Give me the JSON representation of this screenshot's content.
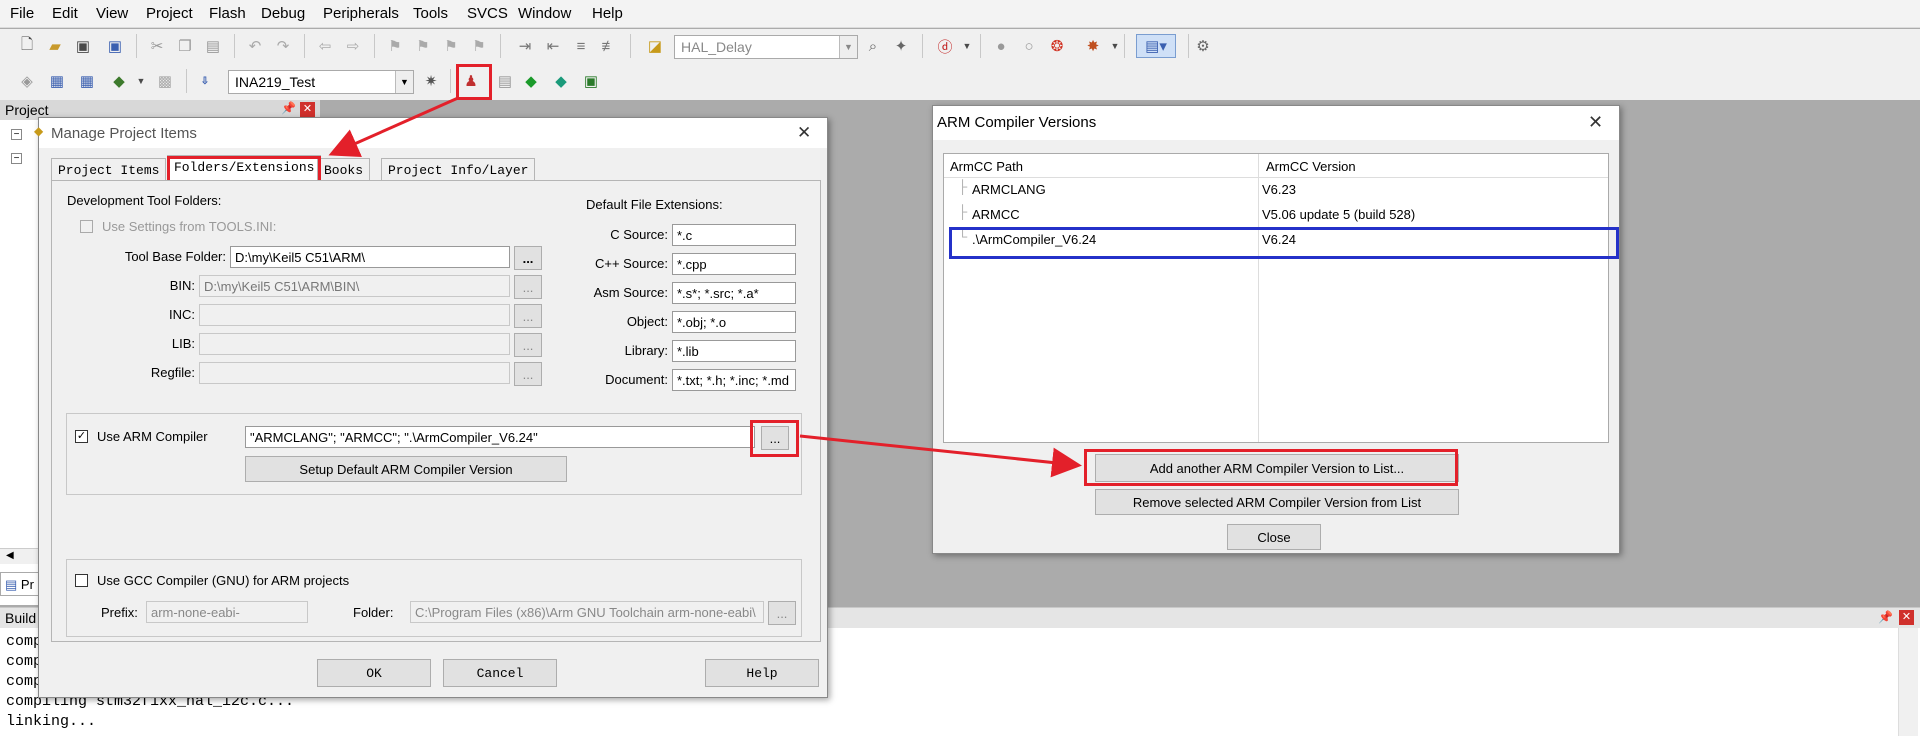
{
  "menu": [
    "File",
    "Edit",
    "View",
    "Project",
    "Flash",
    "Debug",
    "Peripherals",
    "Tools",
    "SVCS",
    "Window",
    "Help"
  ],
  "toolbar": {
    "find_combo": "HAL_Delay",
    "target_combo": "INA219_Test"
  },
  "project_pane": {
    "title": "Project",
    "bottom_tab": "Pr"
  },
  "build_output": {
    "title": "Build O",
    "lines": [
      "comp",
      "comp",
      "comp",
      "compiling stm32f1xx_hal_i2c.c...",
      "linking..."
    ]
  },
  "manage_dialog": {
    "title": "Manage Project Items",
    "tabs": [
      "Project Items",
      "Folders/Extensions",
      "Books",
      "Project Info/Layer"
    ],
    "dev_folders_title": "Development Tool Folders:",
    "use_tools_ini": "Use Settings from TOOLS.INI:",
    "tool_base_label": "Tool Base Folder:",
    "tool_base_value": "D:\\my\\Keil5 C51\\ARM\\",
    "bin_label": "BIN:",
    "bin_value": "D:\\my\\Keil5 C51\\ARM\\BIN\\",
    "inc_label": "INC:",
    "lib_label": "LIB:",
    "regfile_label": "Regfile:",
    "browse": "...",
    "ext_title": "Default File Extensions:",
    "extensions": [
      {
        "label": "C Source:",
        "value": "*.c"
      },
      {
        "label": "C++ Source:",
        "value": "*.cpp"
      },
      {
        "label": "Asm Source:",
        "value": "*.s*; *.src; *.a*"
      },
      {
        "label": "Object:",
        "value": "*.obj; *.o"
      },
      {
        "label": "Library:",
        "value": "*.lib"
      },
      {
        "label": "Document:",
        "value": "*.txt; *.h; *.inc; *.md"
      }
    ],
    "use_arm_label": "Use ARM Compiler",
    "arm_compilers_value": "\"ARMCLANG\"; \"ARMCC\"; \".\\ArmCompiler_V6.24\"",
    "setup_default_btn": "Setup Default ARM Compiler Version",
    "use_gcc_label": "Use GCC Compiler (GNU) for ARM projects",
    "prefix_label": "Prefix:",
    "prefix_value": "arm-none-eabi-",
    "folder_label": "Folder:",
    "folder_value": "C:\\Program Files (x86)\\Arm GNU Toolchain arm-none-eabi\\",
    "ok": "OK",
    "cancel": "Cancel",
    "help": "Help"
  },
  "arm_dialog": {
    "title": "ARM Compiler Versions",
    "col_path": "ArmCC Path",
    "col_version": "ArmCC Version",
    "rows": [
      {
        "path": "ARMCLANG",
        "version": "V6.23"
      },
      {
        "path": "ARMCC",
        "version": "V5.06 update 5 (build 528)"
      },
      {
        "path": ".\\ArmCompiler_V6.24",
        "version": "V6.24"
      }
    ],
    "add_btn": "Add another ARM Compiler Version to List...",
    "remove_btn": "Remove selected ARM Compiler Version from List",
    "close_btn": "Close"
  },
  "colors": {
    "highlight_red": "#e3202a",
    "highlight_blue": "#2431c9"
  }
}
